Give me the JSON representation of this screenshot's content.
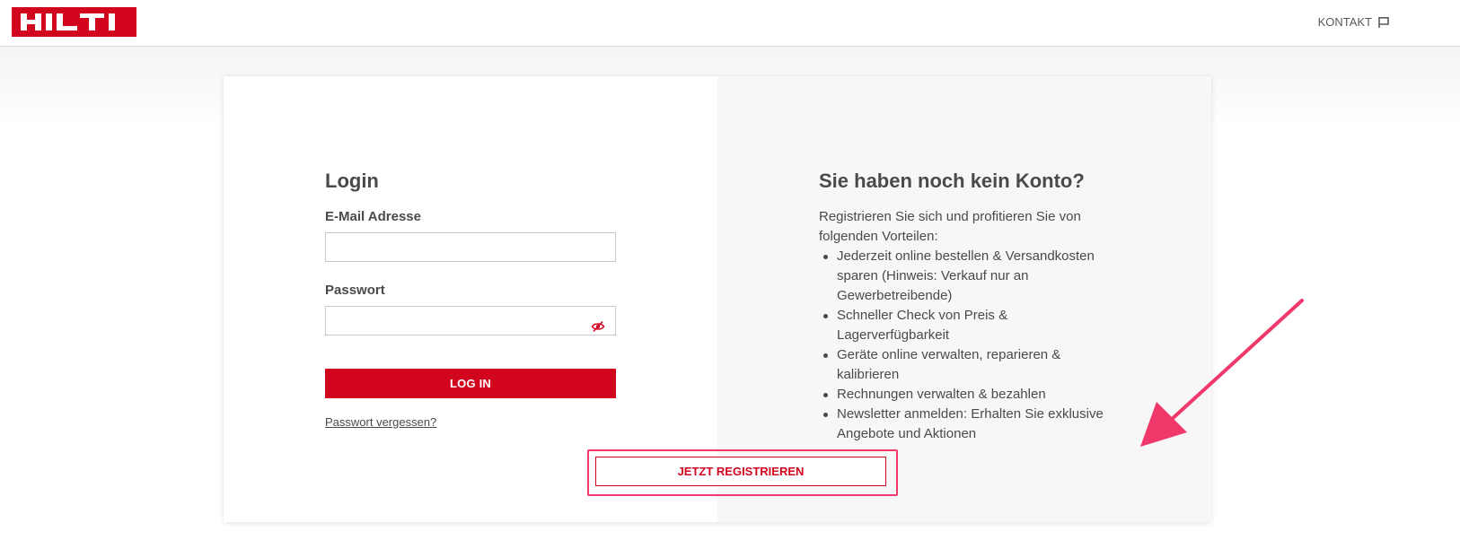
{
  "header": {
    "logo_text": "HILTI",
    "contact_label": "KONTAKT",
    "brand_color": "#d2051e"
  },
  "login": {
    "title": "Login",
    "email_label": "E-Mail Adresse",
    "email_value": "",
    "password_label": "Passwort",
    "password_value": "",
    "login_button": "LOG IN",
    "forgot_password": "Passwort vergessen?"
  },
  "register": {
    "title": "Sie haben noch kein Konto?",
    "intro": "Registrieren Sie sich und profitieren Sie von folgenden Vorteilen:",
    "benefits": [
      "Jederzeit online bestellen & Versandkosten sparen (Hinweis: Verkauf nur an Gewerbetreibende)",
      "Schneller Check von Preis & Lagerverfügbarkeit",
      "Geräte online verwalten, reparieren & kalibrieren",
      "Rechnungen verwalten & bezahlen",
      "Newsletter anmelden: Erhalten Sie exklusive Angebote und Aktionen"
    ],
    "register_button": "JETZT REGISTRIEREN"
  },
  "annotation": {
    "highlight_color": "#f0386b"
  }
}
